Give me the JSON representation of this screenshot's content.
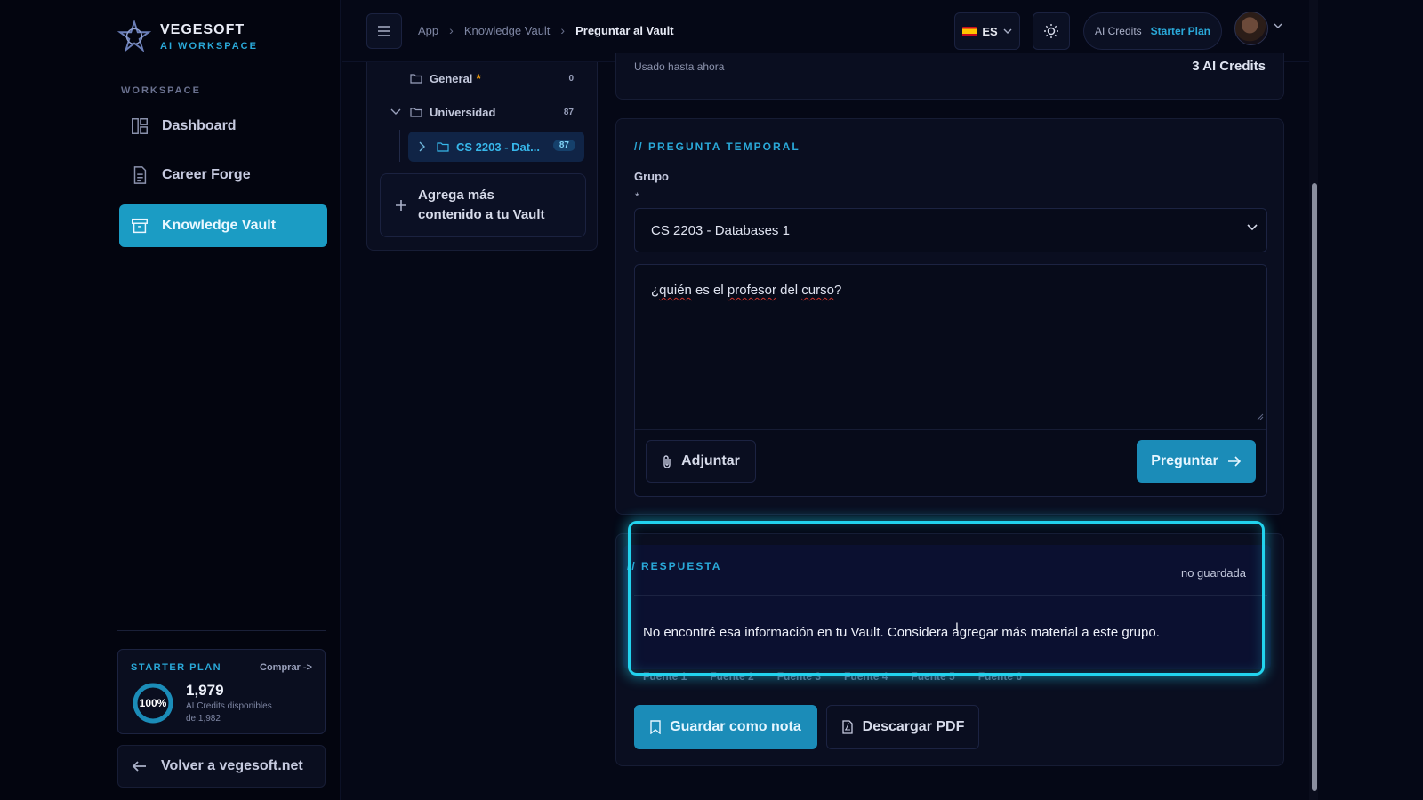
{
  "brand": {
    "name": "VEGESOFT",
    "tagline": "AI WORKSPACE"
  },
  "sidebar": {
    "section_label": "WORKSPACE",
    "items": [
      {
        "label": "Dashboard",
        "icon": "dashboard-icon",
        "active": false
      },
      {
        "label": "Career Forge",
        "icon": "document-icon",
        "active": false
      },
      {
        "label": "Knowledge Vault",
        "icon": "archive-icon",
        "active": true
      }
    ],
    "plan": {
      "title": "STARTER PLAN",
      "buy_label": "Comprar ->",
      "percent_label": "100%",
      "percent": 100,
      "credits": "1,979",
      "credits_sub": "AI Credits disponibles",
      "credits_total": "de 1,982"
    },
    "back_label": "Volver a vegesoft.net"
  },
  "topbar": {
    "breadcrumb": [
      "App",
      "Knowledge Vault",
      "Preguntar al Vault"
    ],
    "lang": "ES",
    "credits_label": "AI Credits",
    "plan_label": "Starter Plan"
  },
  "tree": {
    "items": [
      {
        "label": "General",
        "count": "0",
        "starred": true
      },
      {
        "label": "Universidad",
        "count": "87",
        "expanded": true
      },
      {
        "label": "CS 2203 - Dat...",
        "count": "87",
        "selected": true
      }
    ],
    "add_label_1": "Agrega más",
    "add_label_2": "contenido a tu Vault"
  },
  "usage": {
    "label": "Usado hasta ahora",
    "value": "3 AI Credits"
  },
  "question": {
    "title": "// PREGUNTA TEMPORAL",
    "group_label": "Grupo",
    "required_mark": "*",
    "group_value": "CS 2203 - Databases 1",
    "text_parts": [
      "¿",
      "quién",
      " es el ",
      "profesor",
      " del ",
      "curso",
      "?"
    ],
    "attach_label": "Adjuntar",
    "ask_label": "Preguntar"
  },
  "answer": {
    "title": "// RESPUESTA",
    "status": "no guardada",
    "text": "No encontré esa información en tu Vault. Considera agregar más material a este grupo.",
    "sources": [
      "Fuente 1",
      "Fuente 2",
      "Fuente 3",
      "Fuente 4",
      "Fuente 5",
      "Fuente 6"
    ],
    "save_label": "Guardar como nota",
    "pdf_label": "Descargar PDF"
  },
  "colors": {
    "accent": "#1b9cc4",
    "highlight": "#22d3ee",
    "background": "#050816"
  }
}
